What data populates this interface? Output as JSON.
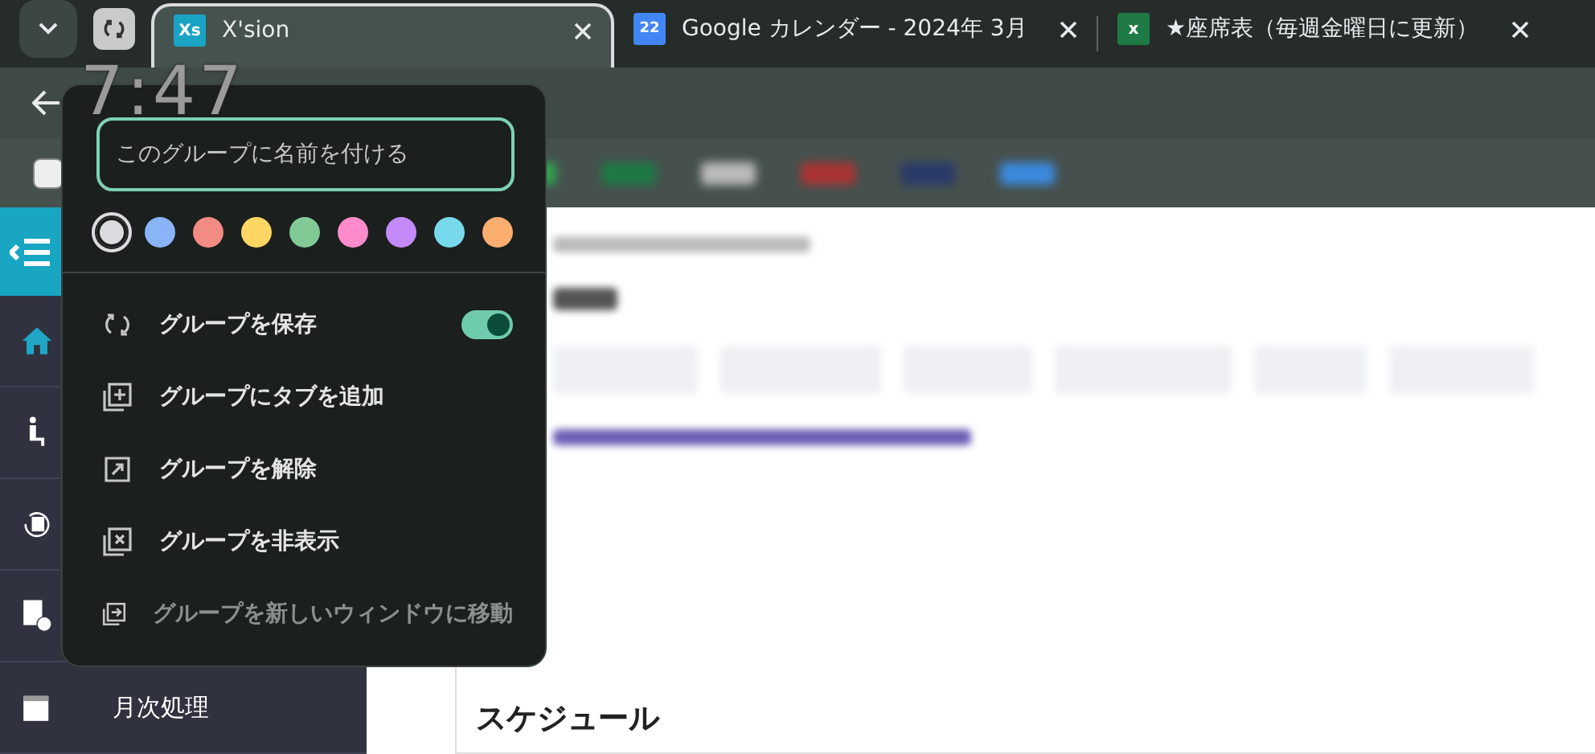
{
  "tab_strip": {
    "tabs": [
      {
        "title": "X'sion",
        "icon_text": "Xs",
        "kind": "xsion",
        "selected": true,
        "in_group": true
      },
      {
        "title": "Google カレンダー - 2024年 3月",
        "icon_text": "22",
        "kind": "calendar",
        "selected": false,
        "in_group": false
      },
      {
        "title": "★座席表（毎週金曜日に更新）",
        "icon_text": "x",
        "kind": "excel",
        "selected": false,
        "in_group": false
      }
    ]
  },
  "clock_overlay": "7:47",
  "group_editor": {
    "name_field": {
      "placeholder": "このグループに名前を付ける"
    },
    "colors": [
      {
        "color": "#dadce0",
        "selected": true
      },
      {
        "color": "#8ab4f8",
        "selected": false
      },
      {
        "color": "#f28b82",
        "selected": false
      },
      {
        "color": "#fdd663",
        "selected": false
      },
      {
        "color": "#81c995",
        "selected": false
      },
      {
        "color": "#ff8bcb",
        "selected": false
      },
      {
        "color": "#c58af9",
        "selected": false
      },
      {
        "color": "#78d9ec",
        "selected": false
      },
      {
        "color": "#fcad70",
        "selected": false
      }
    ],
    "actions": [
      {
        "label": "グループを保存",
        "kind": "save",
        "on": true,
        "disabled": false
      },
      {
        "label": "グループにタブを追加",
        "kind": "add",
        "disabled": false
      },
      {
        "label": "グループを解除",
        "kind": "ungroup",
        "disabled": false
      },
      {
        "label": "グループを非表示",
        "kind": "hide",
        "disabled": false
      },
      {
        "label": "グループを新しいウィンドウに移動",
        "kind": "move",
        "disabled": true
      }
    ]
  },
  "page": {
    "sidebar_items": [
      {
        "kind": "home"
      },
      {
        "kind": "person"
      },
      {
        "kind": "history"
      },
      {
        "kind": "document"
      },
      {
        "kind": "calendar",
        "label": "月次処理"
      }
    ],
    "section_title": "スケジュール"
  }
}
